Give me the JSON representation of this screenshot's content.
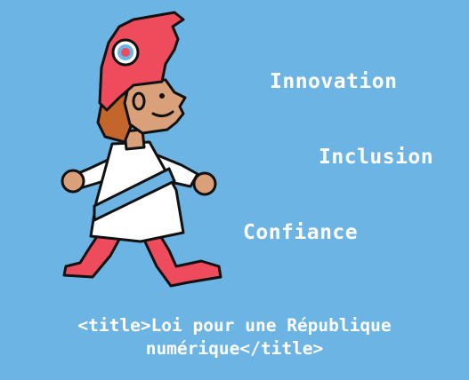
{
  "values": {
    "innovation": "Innovation",
    "inclusion": "Inclusion",
    "confiance": "Confiance"
  },
  "caption": {
    "line1": "<title>Loi pour une République",
    "line2": "numérique</title>"
  },
  "colors": {
    "background": "#6cb4e4",
    "cap": "#ee4c5c",
    "skin": "#d9a07a",
    "hair": "#c4662c",
    "dress": "#ffffff",
    "sash": "#6cb4e4",
    "text": "#ffffff",
    "outline": "#111111"
  },
  "icons": {
    "mascot": "marianne-mascot-icon",
    "cockade": "cockade-icon"
  }
}
